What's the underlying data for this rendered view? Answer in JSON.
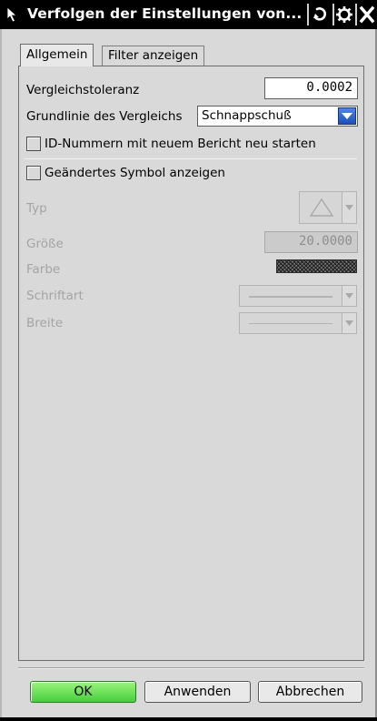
{
  "titlebar": {
    "title": "Verfolgen der Einstellungen von...",
    "icons": [
      "pointer-icon",
      "undo-icon",
      "gear-icon",
      "close-icon"
    ]
  },
  "tabs": [
    {
      "label": "Allgemein",
      "active": true
    },
    {
      "label": "Filter anzeigen",
      "active": false
    }
  ],
  "general": {
    "tolerance_label": "Vergleichstoleranz",
    "tolerance_value": "0.0002",
    "baseline_label": "Grundlinie des Vergleichs",
    "baseline_value": "Schnappschuß",
    "restart_ids_label": "ID-Nummern mit neuem Bericht neu starten",
    "restart_ids_checked": false,
    "show_symbol_label": "Geändertes Symbol anzeigen",
    "show_symbol_checked": false
  },
  "symbol": {
    "type_label": "Typ",
    "type_icon": "triangle-icon",
    "size_label": "Größe",
    "size_value": "20.0000",
    "color_label": "Farbe",
    "font_label": "Schriftart",
    "width_label": "Breite",
    "disabled": true
  },
  "footer": {
    "ok_label": "OK",
    "apply_label": "Anwenden",
    "cancel_label": "Abbrechen"
  },
  "colors": {
    "ok_button": "#5ad84a",
    "dropdown_arrow": "#2f63d6",
    "titlebar": "#000000",
    "disabled_text": "#a4a4a4"
  }
}
